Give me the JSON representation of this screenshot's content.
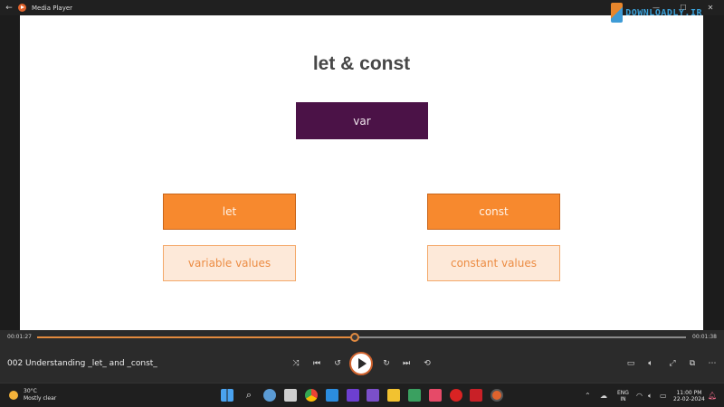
{
  "window": {
    "title": "Media Player"
  },
  "watermark": {
    "text": "DOWNLOADLY.IR"
  },
  "slide": {
    "title": "let & const",
    "var_box": "var",
    "let_box": "let",
    "const_box": "const",
    "let_desc": "variable values",
    "const_desc": "constant values"
  },
  "player": {
    "current_time": "00:01:27",
    "duration": "00:01:38",
    "progress": 0.49,
    "media_title": "002 Understanding _let_ and _const_"
  },
  "taskbar": {
    "temperature": "30°C",
    "condition": "Mostly clear",
    "lang_1": "ENG",
    "lang_2": "IN",
    "time": "11:00 PM",
    "date": "22-02-2024"
  },
  "colors": {
    "var_box": "#4b1247",
    "orange": "#f7892e",
    "light_orange": "#fde9d9",
    "seek_fill": "#e28a3e"
  }
}
